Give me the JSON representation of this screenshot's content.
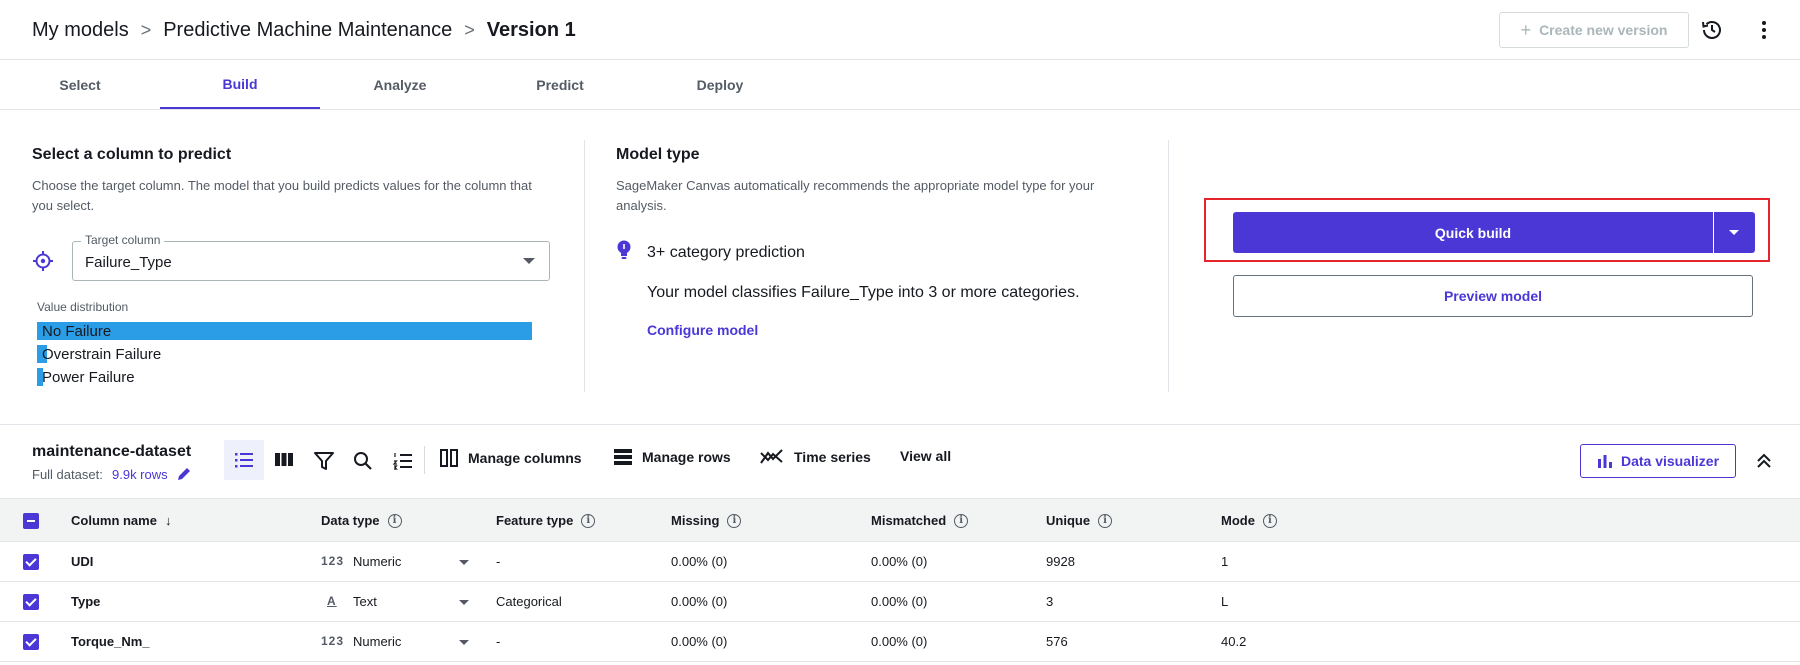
{
  "breadcrumb": {
    "items": [
      "My models",
      "Predictive Machine Maintenance",
      "Version 1"
    ],
    "separator": ">"
  },
  "header": {
    "create_version_label": "Create new version"
  },
  "tabs": [
    "Select",
    "Build",
    "Analyze",
    "Predict",
    "Deploy"
  ],
  "active_tab": "Build",
  "predict_panel": {
    "title": "Select a column to predict",
    "description": "Choose the target column. The model that you build predicts values for the column that you select.",
    "target_label": "Target column",
    "target_value": "Failure_Type",
    "value_distribution_label": "Value distribution",
    "distribution": [
      {
        "label": "No Failure",
        "fraction": 1.0
      },
      {
        "label": "Overstrain Failure",
        "fraction": 0.02
      },
      {
        "label": "Power Failure",
        "fraction": 0.01
      }
    ]
  },
  "model_type": {
    "title": "Model type",
    "description": "SageMaker Canvas automatically recommends the appropriate model type for your analysis.",
    "category": "3+ category prediction",
    "explanation": "Your model classifies Failure_Type into 3 or more categories.",
    "configure_label": "Configure model"
  },
  "actions": {
    "quick_build": "Quick build",
    "preview_model": "Preview model"
  },
  "dataset": {
    "name": "maintenance-dataset",
    "full_label": "Full dataset:",
    "rows_label": "9.9k rows"
  },
  "toolbar": {
    "manage_columns": "Manage columns",
    "manage_rows": "Manage rows",
    "time_series": "Time series",
    "view_all": "View all",
    "data_visualizer": "Data visualizer"
  },
  "table": {
    "headers": [
      "Column name",
      "Data type",
      "Feature type",
      "Missing",
      "Mismatched",
      "Unique",
      "Mode"
    ],
    "rows": [
      {
        "name": "UDI",
        "type_icon": "123",
        "type": "Numeric",
        "feature": "-",
        "missing": "0.00% (0)",
        "mismatched": "0.00% (0)",
        "unique": "9928",
        "mode": "1"
      },
      {
        "name": "Type",
        "type_icon": "A",
        "type": "Text",
        "feature": "Categorical",
        "missing": "0.00% (0)",
        "mismatched": "0.00% (0)",
        "unique": "3",
        "mode": "L"
      },
      {
        "name": "Torque_Nm_",
        "type_icon": "123",
        "type": "Numeric",
        "feature": "-",
        "missing": "0.00% (0)",
        "mismatched": "0.00% (0)",
        "unique": "576",
        "mode": "40.2"
      }
    ]
  },
  "colors": {
    "accent": "#4a37d6",
    "distribution_bar": "#2b9de6",
    "highlight": "#e4262c"
  }
}
